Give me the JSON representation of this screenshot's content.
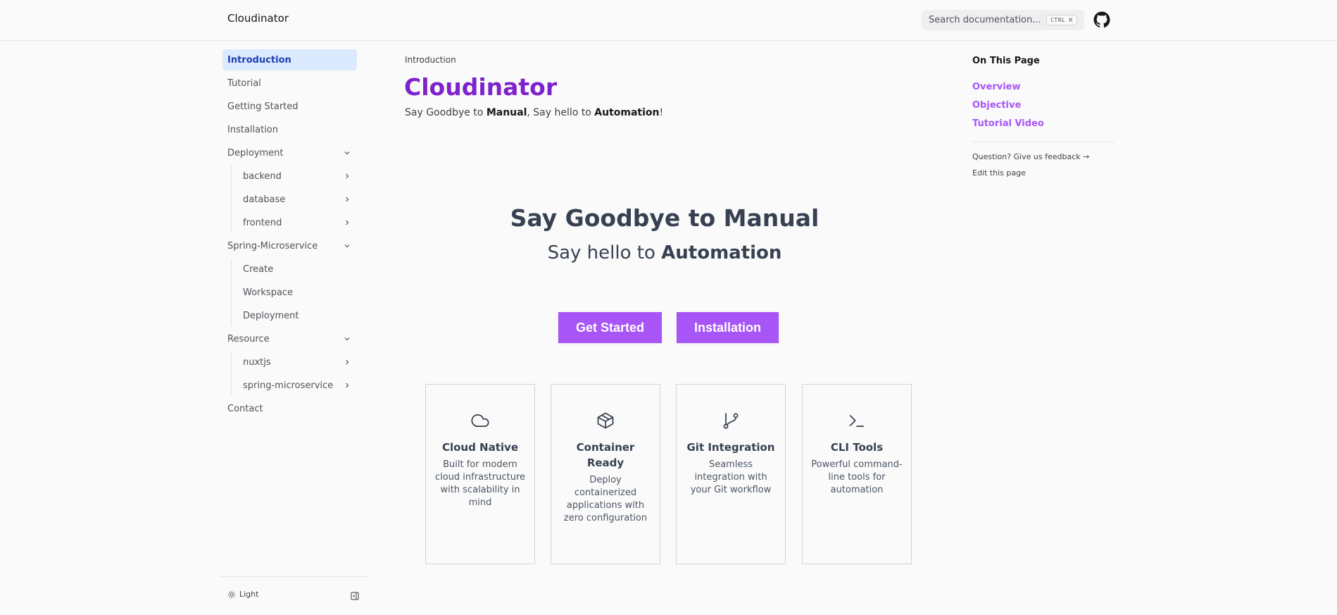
{
  "header": {
    "brand": "Cloudinator",
    "search_placeholder": "Search documentation...",
    "search_shortcut": "CTRL K",
    "github_icon": "github-icon"
  },
  "sidebar": {
    "items": [
      {
        "label": "Introduction",
        "active": true
      },
      {
        "label": "Tutorial"
      },
      {
        "label": "Getting Started"
      },
      {
        "label": "Installation"
      },
      {
        "label": "Deployment",
        "expanded": true,
        "children": [
          {
            "label": "backend"
          },
          {
            "label": "database"
          },
          {
            "label": "frontend"
          }
        ]
      },
      {
        "label": "Spring-Microservice",
        "expanded": true,
        "children": [
          {
            "label": "Create"
          },
          {
            "label": "Workspace"
          },
          {
            "label": "Deployment"
          }
        ]
      },
      {
        "label": "Resource",
        "expanded": true,
        "children": [
          {
            "label": "nuxtjs"
          },
          {
            "label": "spring-microservice"
          }
        ]
      },
      {
        "label": "Contact"
      }
    ],
    "theme_label": "Light"
  },
  "main": {
    "breadcrumb": "Introduction",
    "title": "Cloudinator",
    "subtitle": {
      "p1": "Say Goodbye to ",
      "b1": "Manual",
      "p2": ", Say hello to ",
      "b2": "Automation",
      "p3": "!"
    },
    "hero_line1": "Say Goodbye to Manual",
    "hero_line2_prefix": "Say hello to ",
    "hero_line2_bold": "Automation",
    "buttons": {
      "primary": "Get Started",
      "secondary": "Installation"
    },
    "cards": [
      {
        "icon": "cloud-icon",
        "title": "Cloud Native",
        "desc": "Built for modern cloud infrastructure with scalability in mind"
      },
      {
        "icon": "box-icon",
        "title": "Container Ready",
        "desc": "Deploy containerized applications with zero configuration"
      },
      {
        "icon": "git-branch-icon",
        "title": "Git Integration",
        "desc": "Seamless integration with your Git workflow"
      },
      {
        "icon": "terminal-icon",
        "title": "CLI Tools",
        "desc": "Powerful command-line tools for automation"
      }
    ]
  },
  "toc": {
    "heading": "On This Page",
    "items": [
      "Overview",
      "Objective",
      "Tutorial Video"
    ],
    "feedback": "Question? Give us feedback →",
    "edit": "Edit this page"
  },
  "colors": {
    "accent": "#a855f7",
    "title": "#7e22ce",
    "active_bg": "#dbeafe",
    "active_text": "#1e40af"
  }
}
